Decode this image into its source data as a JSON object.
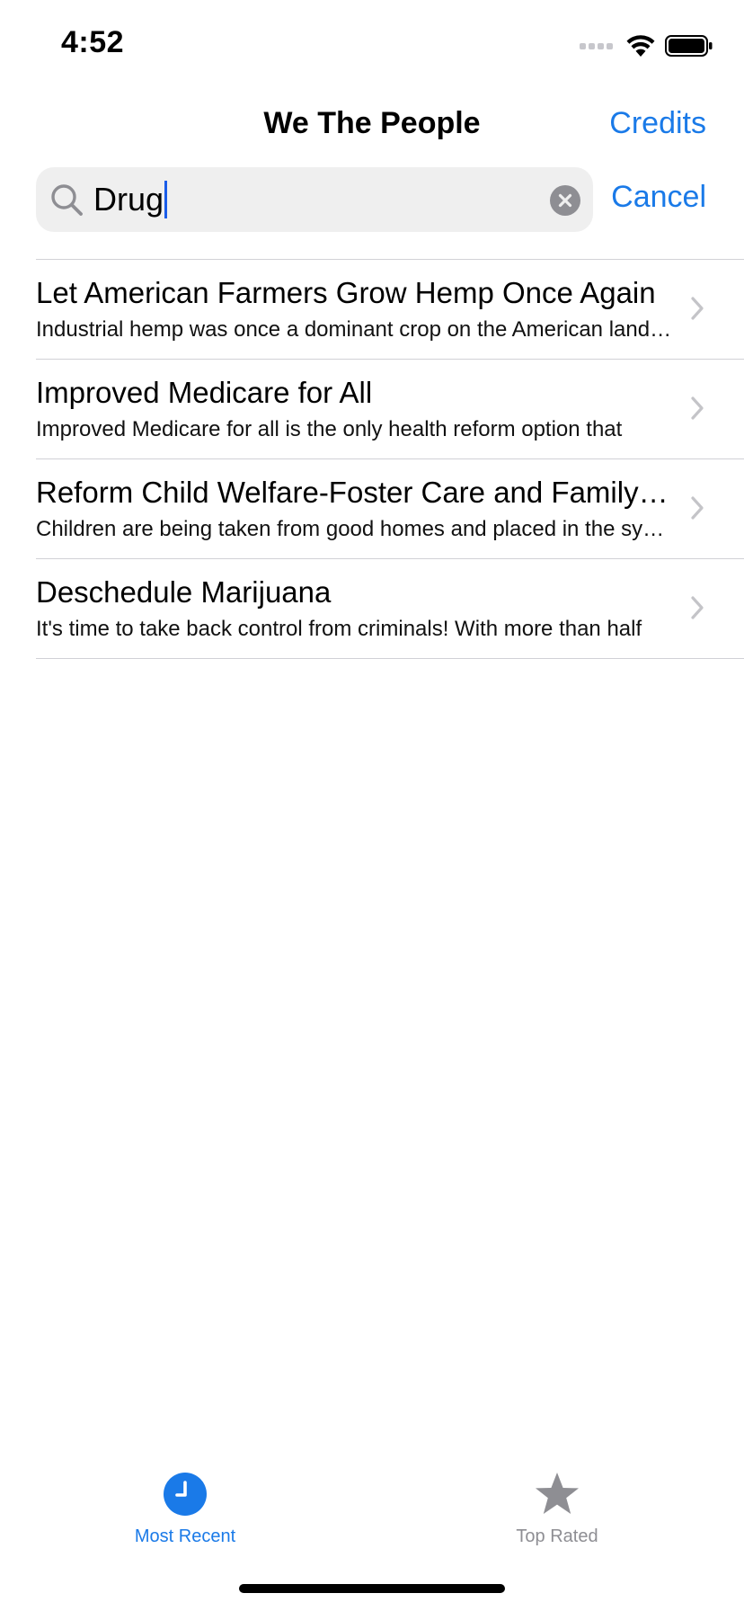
{
  "status_bar": {
    "time": "4:52"
  },
  "nav": {
    "title": "We The People",
    "credits_label": "Credits"
  },
  "search": {
    "value": "Drug",
    "cancel_label": "Cancel"
  },
  "results": [
    {
      "title": "Let American Farmers Grow Hemp Once Again",
      "subtitle": "Industrial hemp was once a dominant crop on the American landscape"
    },
    {
      "title": "Improved Medicare for All",
      "subtitle": "Improved Medicare for all is the only health reform option that"
    },
    {
      "title": "Reform Child Welfare-Foster Care and Family Courts",
      "subtitle": "Children are being taken from good homes and placed in the system"
    },
    {
      "title": "Deschedule Marijuana",
      "subtitle": "It's time to take back control from criminals! With more than half"
    }
  ],
  "tab_bar": {
    "tabs": [
      {
        "label": "Most Recent",
        "icon": "clock-icon",
        "selected": true
      },
      {
        "label": "Top Rated",
        "icon": "star-icon",
        "selected": false
      }
    ]
  },
  "colors": {
    "accent": "#1a7ae8",
    "inactive": "#8e8e93",
    "search_background": "#efefef",
    "separator": "#d1d1d6"
  }
}
